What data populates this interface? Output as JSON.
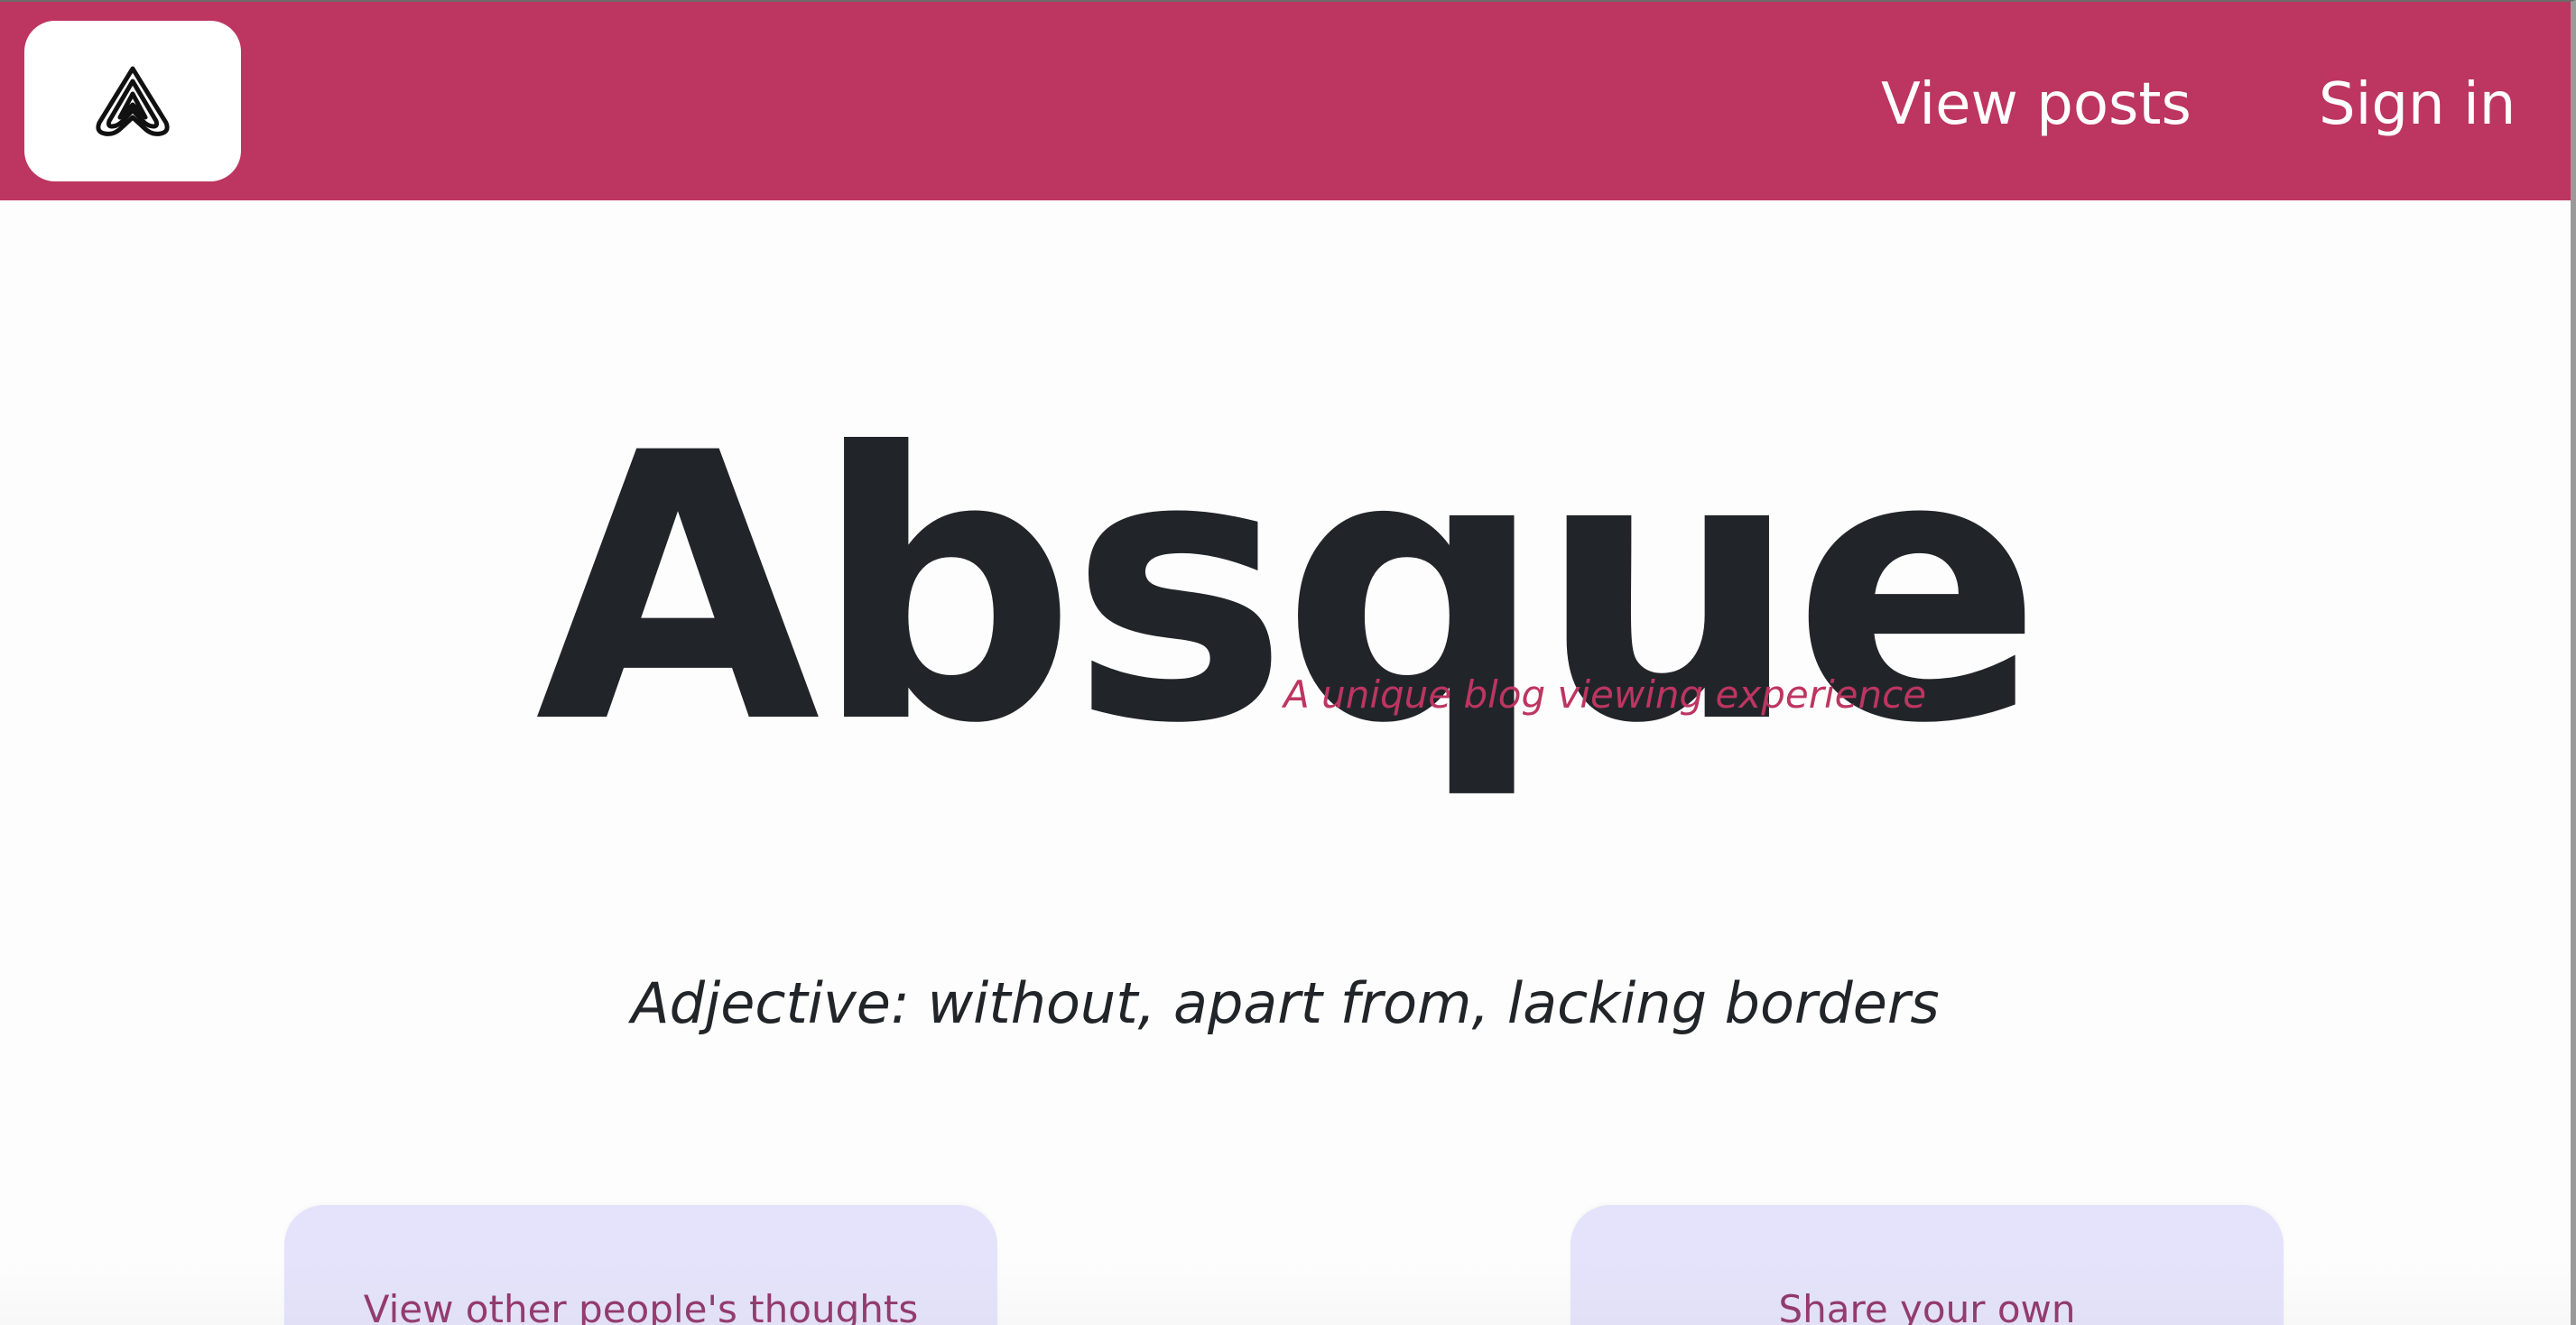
{
  "navbar": {
    "logo_icon": "absque-logo-icon",
    "links": [
      {
        "label": "View posts"
      },
      {
        "label": "Sign in"
      }
    ],
    "background_color": "#bd3561"
  },
  "hero": {
    "title": "Absque",
    "subtitle": "A unique blog viewing experience",
    "definition": "Adjective: without, apart from, lacking borders"
  },
  "cards": [
    {
      "label": "View other people's thoughts"
    },
    {
      "label": "Share your own"
    }
  ],
  "colors": {
    "accent": "#bd3561",
    "text_dark": "#212529",
    "card_bg": "#e4e3fb",
    "card_text": "#8e2f66"
  }
}
